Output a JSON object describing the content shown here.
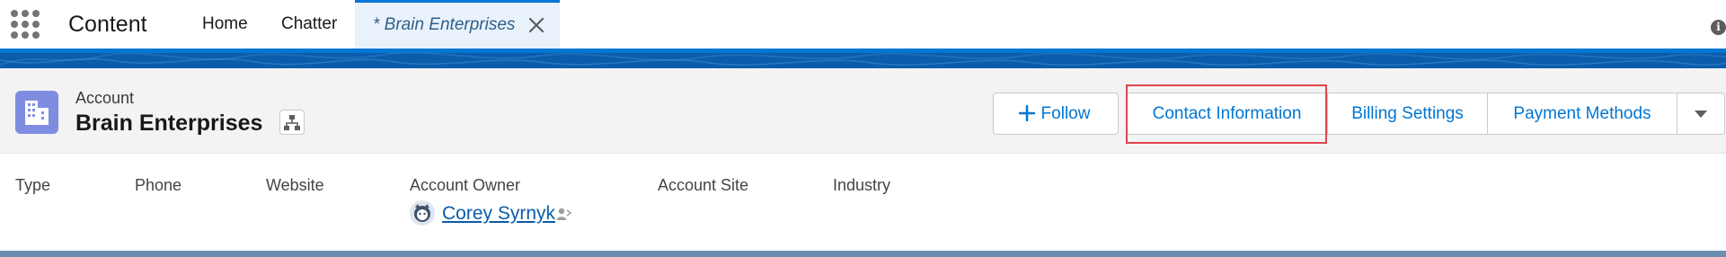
{
  "app": {
    "name": "Content",
    "launcher_icon": "app-launcher-grid-icon"
  },
  "nav": {
    "tabs": [
      {
        "label": "Home"
      },
      {
        "label": "Chatter"
      },
      {
        "label": "* Brain Enterprises"
      }
    ],
    "close_icon": "close-icon"
  },
  "record": {
    "object_label": "Account",
    "name": "Brain Enterprises",
    "icon": "account-building-icon",
    "hierarchy_icon": "hierarchy-icon"
  },
  "actions": {
    "follow_label": "Follow",
    "buttons": [
      {
        "label": "Contact Information"
      },
      {
        "label": "Billing Settings"
      },
      {
        "label": "Payment Methods"
      }
    ],
    "more_icon": "chevron-down-icon"
  },
  "highlights": {
    "fields": [
      {
        "label": "Type"
      },
      {
        "label": "Phone"
      },
      {
        "label": "Website"
      },
      {
        "label": "Account Owner"
      },
      {
        "label": "Account Site"
      },
      {
        "label": "Industry"
      }
    ],
    "owner_name": "Corey Syrnyk"
  },
  "colors": {
    "brand_blue": "#0176d3",
    "dark_blue": "#0b5cab",
    "record_icon": "#7f8de1",
    "highlight_red": "#e0454c"
  }
}
